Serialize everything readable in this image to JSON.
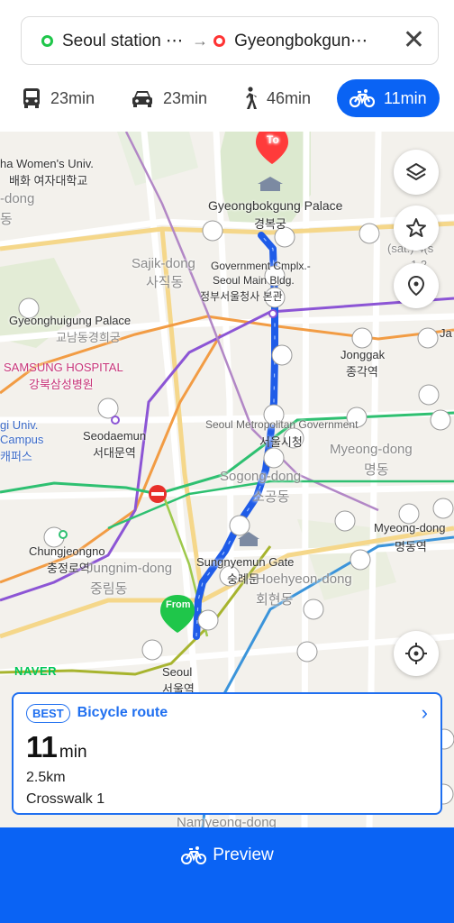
{
  "route": {
    "origin": "Seoul station ⋯",
    "destination": "Gyeongbokgun⋯",
    "arrow": "→"
  },
  "modes": [
    {
      "icon": "bus-icon",
      "label": "23min",
      "active": false
    },
    {
      "icon": "car-icon",
      "label": "23min",
      "active": false
    },
    {
      "icon": "walk-icon",
      "label": "46min",
      "active": false
    },
    {
      "icon": "bicycle-icon",
      "label": "11min",
      "active": true
    }
  ],
  "map": {
    "to_pin": "To",
    "from_pin": "From",
    "labels": {
      "womens_univ": "ha Women's Univ.",
      "womens_univ_kr": "배화 여자대학교",
      "dong_left1": "-dong",
      "dong_left1_kr": "동",
      "palace": "Gyeongbokgung Palace",
      "palace_kr": "경복궁",
      "sajik": "Sajik-dong",
      "sajik_kr": "사직동",
      "gov": "Government Cmplx.-",
      "gov2": "Seoul Main Bldg.",
      "gov_kr": "정부서울청사 본관",
      "gyeonghui": "Gyeonghuigung Palace",
      "gyonam_kr": "교남동경희궁",
      "samsung": "SAMSUNG HOSPITAL",
      "samsung_kr": "강북삼성병원",
      "jonggak": "Jonggak",
      "jonggak_kr": "종각역",
      "seodaemun": "Seodaemun",
      "seodaemun_kr": "서대문역",
      "cityhall_en": "Seoul Metropolitan Government",
      "cityhall_kr": "서울시청",
      "myeongdong_area": "Myeong-dong",
      "myeongdong_area_kr": "명동",
      "sogong": "Sogong-dong",
      "sogong_kr": "소공동",
      "myeongdong_stn": "Myeong-dong",
      "myeongdong_stn_kr": "명동역",
      "gi_univ": "gi Univ.",
      "campus": "Campus",
      "campus_kr": "캐퍼스",
      "chungjeongno": "Chungjeongno",
      "chungjeongno_kr": "충정로역",
      "jungnim": "Jungnim-dong",
      "jungnim_kr": "중림동",
      "sungnyemun": "Sungnyemun Gate",
      "sungnyemun_kr": "숭례문",
      "hoehyeon": "Hoehyeon-dong",
      "hoehyeon_kr": "회현동",
      "seoul": "Seoul",
      "seoul_kr": "서울역",
      "namyeong": "Namyeong-dong",
      "ja": "Ja",
      "sat": "(sat.) 4(s",
      "sat2": "1.2"
    },
    "naver": "NAVER"
  },
  "card": {
    "badge": "BEST",
    "title": "Bicycle route",
    "duration_num": "11",
    "duration_unit": "min",
    "distance": "2.5km",
    "crosswalk": "Crosswalk 1"
  },
  "preview_label": "Preview",
  "colors": {
    "accent": "#0a63f4",
    "route": "#1f5ce8",
    "origin_dot": "#1fc64a",
    "dest_dot": "#ff3333"
  }
}
